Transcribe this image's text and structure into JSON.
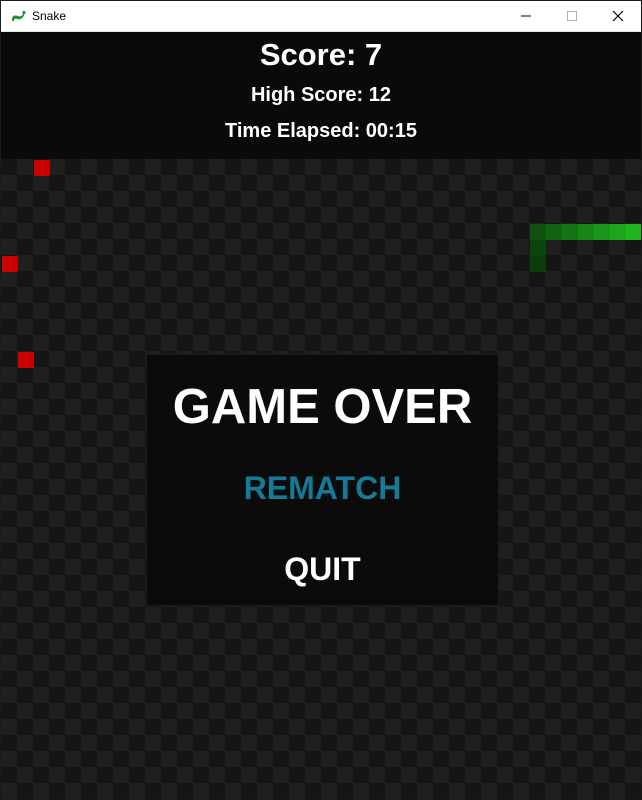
{
  "window": {
    "title": "Snake",
    "icon": "snake-icon",
    "controls": [
      "minimize-icon",
      "maximize-icon",
      "close-icon"
    ]
  },
  "hud": {
    "score": "Score: 7",
    "high_score": "High Score: 12",
    "time_elapsed": "Time Elapsed: 00:15"
  },
  "game_over": {
    "title": "GAME OVER",
    "rematch": "REMATCH",
    "quit": "QUIT"
  },
  "colors": {
    "food": "#c80000",
    "snake_head": "#1fb51f",
    "snake_tail": "#0a3d0a",
    "rematch_accent": "#147a96",
    "board_dark": "#151515",
    "board_light": "#1f1f1f"
  }
}
